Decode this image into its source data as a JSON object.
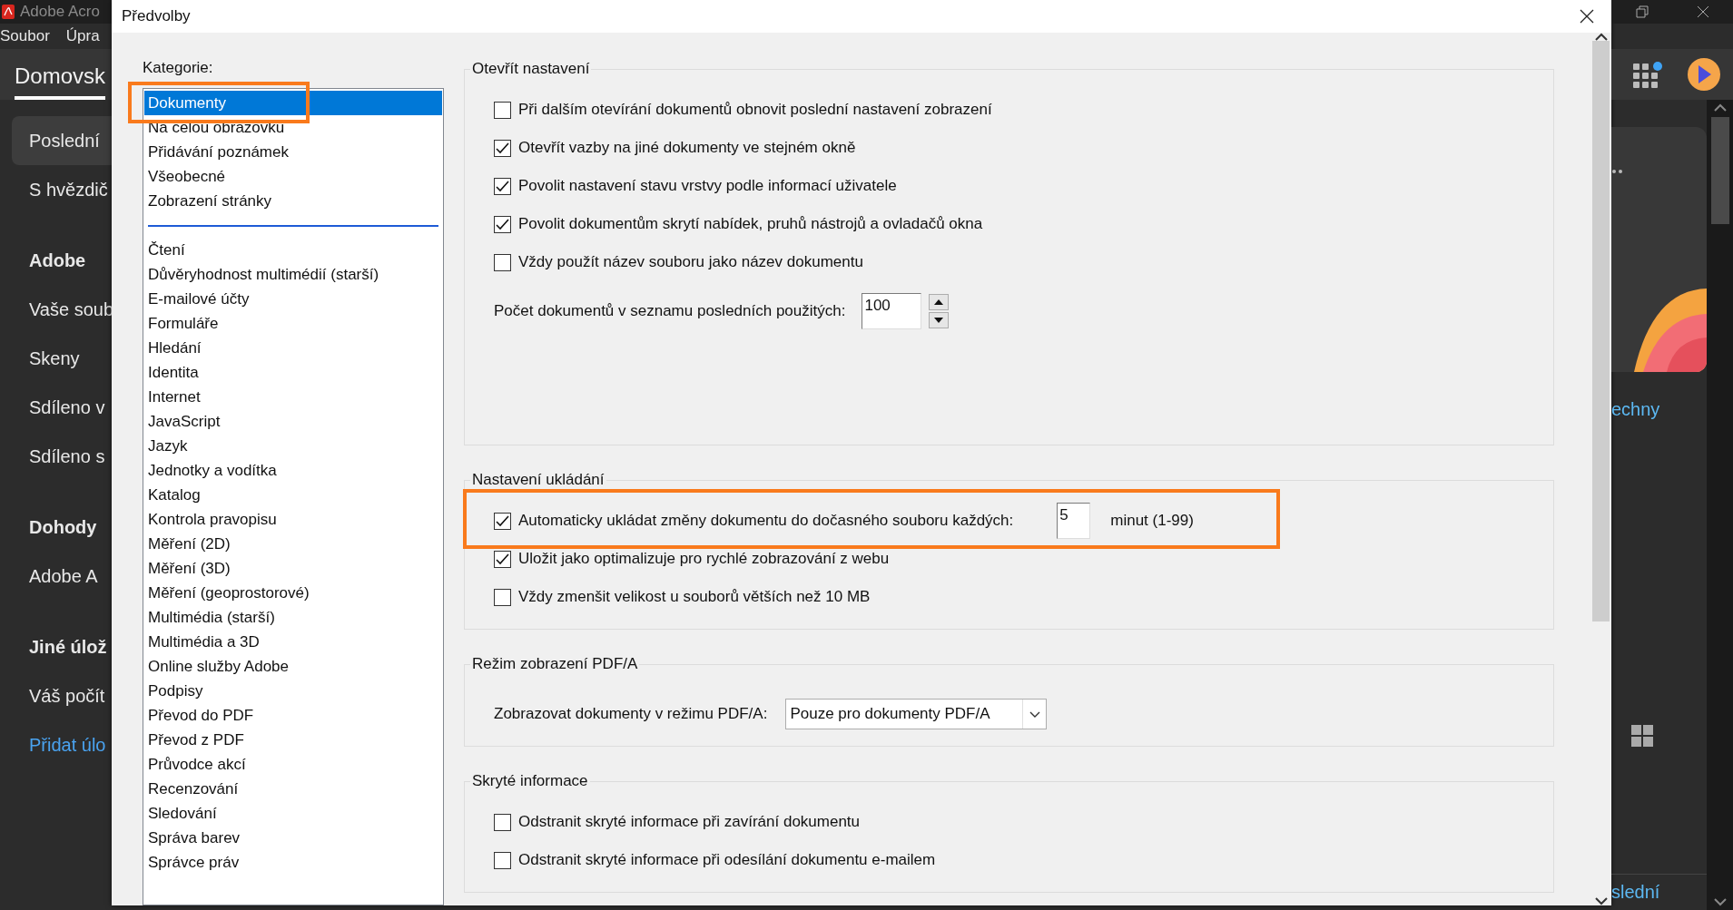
{
  "app": {
    "title": "Adobe Acro",
    "menu": [
      "Soubor",
      "Úpra"
    ],
    "home_tab": "Domovsk",
    "nav": [
      {
        "label": "Poslední",
        "kind": "item",
        "selected": true
      },
      {
        "label": "S hvězdič",
        "kind": "item",
        "selected": false
      },
      {
        "label": "Adobe",
        "kind": "heading",
        "selected": false
      },
      {
        "label": "Vaše soub",
        "kind": "item",
        "selected": false
      },
      {
        "label": "Skeny",
        "kind": "item",
        "selected": false
      },
      {
        "label": "Sdíleno v",
        "kind": "item",
        "selected": false
      },
      {
        "label": "Sdíleno s",
        "kind": "item",
        "selected": false
      },
      {
        "label": "Dohody",
        "kind": "heading",
        "selected": false
      },
      {
        "label": "Adobe A",
        "kind": "item",
        "selected": false
      },
      {
        "label": "Jiné úlož",
        "kind": "heading",
        "selected": false
      },
      {
        "label": "Váš počít",
        "kind": "item",
        "selected": false
      },
      {
        "label": "Přidat úlo",
        "kind": "link",
        "selected": false
      }
    ],
    "right_link": "echny",
    "bottom_link": "slední"
  },
  "dialog": {
    "title": "Předvolby",
    "categories_label": "Kategorie:",
    "category_groups": [
      {
        "items": [
          {
            "label": "Dokumenty",
            "selected": true,
            "highlighted": true
          },
          {
            "label": "Na celou obrazovku",
            "selected": false,
            "highlighted": false
          },
          {
            "label": "Přidávání poznámek",
            "selected": false,
            "highlighted": false
          },
          {
            "label": "Všeobecné",
            "selected": false,
            "highlighted": false
          },
          {
            "label": "Zobrazení stránky",
            "selected": false,
            "highlighted": false
          }
        ]
      },
      {
        "items": [
          {
            "label": "Čtení",
            "selected": false,
            "highlighted": false
          },
          {
            "label": "Důvěryhodnost multimédií (starší)",
            "selected": false,
            "highlighted": false
          },
          {
            "label": "E-mailové účty",
            "selected": false,
            "highlighted": false
          },
          {
            "label": "Formuláře",
            "selected": false,
            "highlighted": false
          },
          {
            "label": "Hledání",
            "selected": false,
            "highlighted": false
          },
          {
            "label": "Identita",
            "selected": false,
            "highlighted": false
          },
          {
            "label": "Internet",
            "selected": false,
            "highlighted": false
          },
          {
            "label": "JavaScript",
            "selected": false,
            "highlighted": false
          },
          {
            "label": "Jazyk",
            "selected": false,
            "highlighted": false
          },
          {
            "label": "Jednotky a vodítka",
            "selected": false,
            "highlighted": false
          },
          {
            "label": "Katalog",
            "selected": false,
            "highlighted": false
          },
          {
            "label": "Kontrola pravopisu",
            "selected": false,
            "highlighted": false
          },
          {
            "label": "Měření (2D)",
            "selected": false,
            "highlighted": false
          },
          {
            "label": "Měření (3D)",
            "selected": false,
            "highlighted": false
          },
          {
            "label": "Měření (geoprostorové)",
            "selected": false,
            "highlighted": false
          },
          {
            "label": "Multimédia (starší)",
            "selected": false,
            "highlighted": false
          },
          {
            "label": "Multimédia a 3D",
            "selected": false,
            "highlighted": false
          },
          {
            "label": "Online služby Adobe",
            "selected": false,
            "highlighted": false
          },
          {
            "label": "Podpisy",
            "selected": false,
            "highlighted": false
          },
          {
            "label": "Převod do PDF",
            "selected": false,
            "highlighted": false
          },
          {
            "label": "Převod z PDF",
            "selected": false,
            "highlighted": false
          },
          {
            "label": "Průvodce akcí",
            "selected": false,
            "highlighted": false
          },
          {
            "label": "Recenzování",
            "selected": false,
            "highlighted": false
          },
          {
            "label": "Sledování",
            "selected": false,
            "highlighted": false
          },
          {
            "label": "Správa barev",
            "selected": false,
            "highlighted": false
          },
          {
            "label": "Správce práv",
            "selected": false,
            "highlighted": false
          }
        ]
      }
    ],
    "sections": [
      {
        "title": "Otevřít nastavení",
        "rows": [
          {
            "kind": "checkbox",
            "label": "Při dalším otevírání dokumentů obnovit poslední nastavení zobrazení",
            "checked": false
          },
          {
            "kind": "checkbox",
            "label": "Otevřít vazby na jiné dokumenty ve stejném okně",
            "checked": true
          },
          {
            "kind": "checkbox",
            "label": "Povolit nastavení stavu vrstvy podle informací uživatele",
            "checked": true
          },
          {
            "kind": "checkbox",
            "label": "Povolit dokumentům skrytí nabídek, pruhů nástrojů a ovladačů okna",
            "checked": true
          },
          {
            "kind": "checkbox",
            "label": "Vždy použít název souboru jako název dokumentu",
            "checked": false
          },
          {
            "kind": "spinner",
            "label": "Počet dokumentů v seznamu posledních použitých:",
            "value": "100"
          }
        ]
      },
      {
        "title": "Nastavení ukládání",
        "rows": [
          {
            "kind": "checkbox_input",
            "label": "Automaticky ukládat změny dokumentu do dočasného souboru každých:",
            "checked": true,
            "highlighted": true,
            "value": "5",
            "unit": "minut (1-99)"
          },
          {
            "kind": "checkbox",
            "label": "Uložit jako optimalizuje pro rychlé zobrazování z webu",
            "checked": true
          },
          {
            "kind": "checkbox",
            "label": "Vždy zmenšit velikost u souborů větších než 10 MB",
            "checked": false
          }
        ]
      },
      {
        "title": "Režim zobrazení PDF/A",
        "rows": [
          {
            "kind": "select",
            "label": "Zobrazovat dokumenty v režimu PDF/A:",
            "value": "Pouze pro dokumenty PDF/A"
          }
        ]
      },
      {
        "title": "Skryté informace",
        "rows": [
          {
            "kind": "checkbox",
            "label": "Odstranit skryté informace při zavírání dokumentu",
            "checked": false
          },
          {
            "kind": "checkbox",
            "label": "Odstranit skryté informace při odesílání dokumentu e-mailem",
            "checked": false
          }
        ]
      }
    ]
  }
}
